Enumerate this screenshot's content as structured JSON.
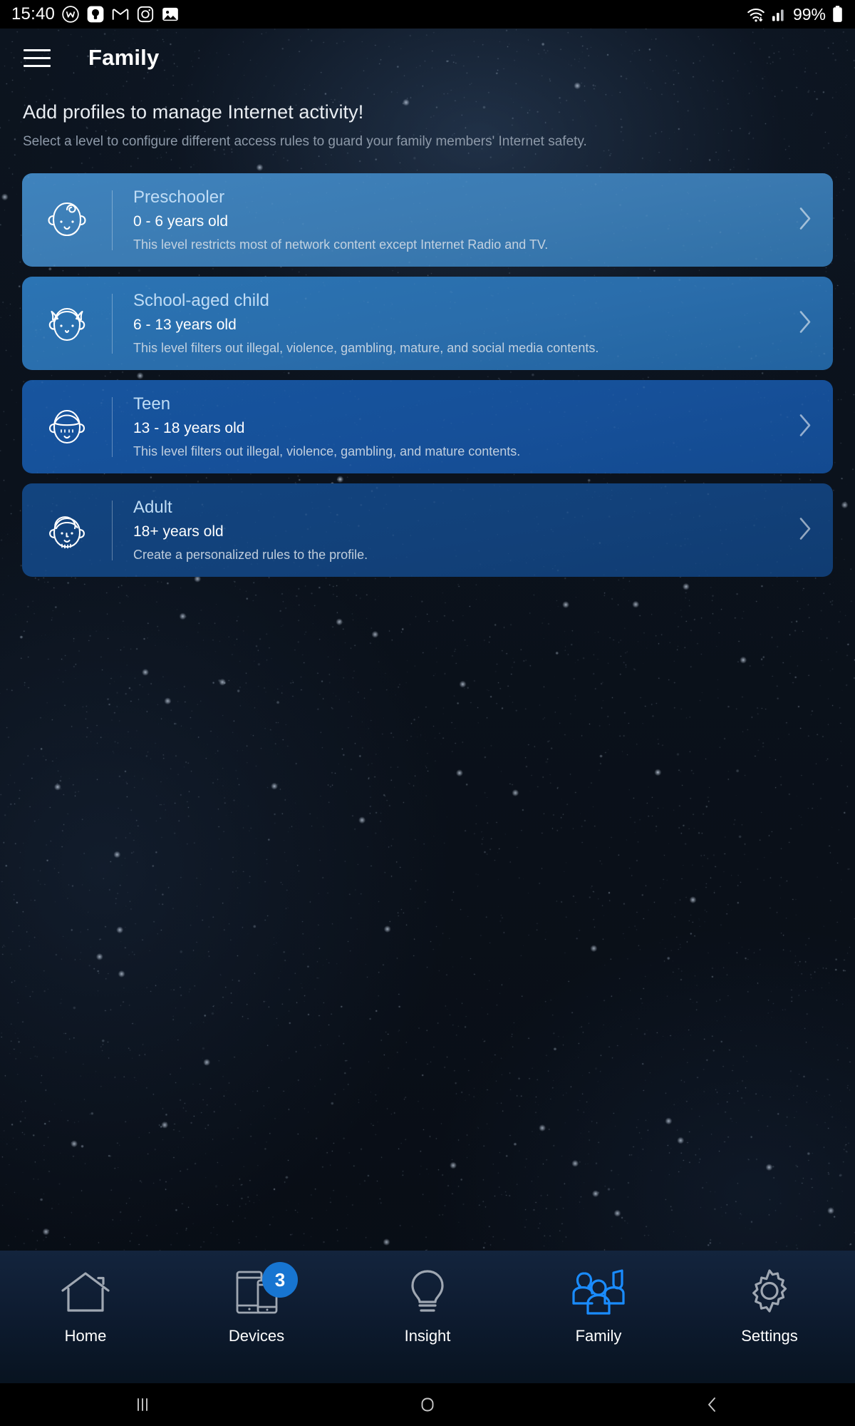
{
  "status_bar": {
    "time": "15:40",
    "battery_percent": "99%",
    "left_icons": [
      "w-circle-icon",
      "bulb-square-icon",
      "gmail-icon",
      "instagram-icon",
      "photos-icon"
    ],
    "right_icons": [
      "wifi-icon",
      "cellular-signal-icon",
      "battery-icon"
    ]
  },
  "app_bar": {
    "menu_icon": "hamburger-menu-icon",
    "title": "Family"
  },
  "intro": {
    "title": "Add profiles to manage Internet activity!",
    "subtitle": "Select a level to configure different access rules to guard your family members' Internet safety."
  },
  "colors": {
    "accent": "#1775d1",
    "card_title": "#bfdcf5",
    "preschooler": "#3b7ab1",
    "school_aged": "#2a6dab",
    "teen": "#165099",
    "adult": "#12417a"
  },
  "profile_levels": [
    {
      "title": "Preschooler",
      "age": "0 - 6 years old",
      "description": "This level restricts most of network content except Internet Radio and TV.",
      "avatar_icon": "baby-face-icon",
      "chevron_icon": "chevron-right-icon"
    },
    {
      "title": "School-aged child",
      "age": "6 - 13 years old",
      "description": "This level filters out illegal, violence, gambling, mature, and social media contents.",
      "avatar_icon": "girl-face-icon",
      "chevron_icon": "chevron-right-icon"
    },
    {
      "title": "Teen",
      "age": "13 - 18 years old",
      "description": "This level filters out illegal, violence, gambling, and mature contents.",
      "avatar_icon": "teen-face-icon",
      "chevron_icon": "chevron-right-icon"
    },
    {
      "title": "Adult",
      "age": "18+ years old",
      "description": "Create a personalized rules to the profile.",
      "avatar_icon": "adult-face-icon",
      "chevron_icon": "chevron-right-icon"
    }
  ],
  "bottom_nav": [
    {
      "label": "Home",
      "icon": "home-icon",
      "active": false,
      "badge": ""
    },
    {
      "label": "Devices",
      "icon": "devices-icon",
      "active": false,
      "badge": "3"
    },
    {
      "label": "Insight",
      "icon": "lightbulb-icon",
      "active": false,
      "badge": ""
    },
    {
      "label": "Family",
      "icon": "family-group-icon",
      "active": true,
      "badge": ""
    },
    {
      "label": "Settings",
      "icon": "gear-icon",
      "active": false,
      "badge": ""
    }
  ],
  "android_nav": {
    "recents_icon": "recents-icon",
    "home_icon": "home-circle-icon",
    "back_icon": "back-chevron-icon"
  }
}
